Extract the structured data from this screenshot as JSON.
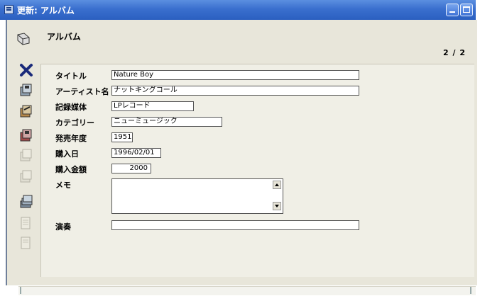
{
  "window": {
    "title": "更新: アルバム",
    "title_icon": "grid-window-icon",
    "minimize_icon": "minimize-icon",
    "maximize_icon": "maximize-icon"
  },
  "header": {
    "title": "アルバム",
    "record_count": "2 / 2",
    "icon": "book-page-icon"
  },
  "toolbar": {
    "icons": [
      "delete-x-icon",
      "save-disk-icon",
      "edit-disk-icon",
      "copy-disk-icon",
      "disabled-disk-icon",
      "disabled-disk2-icon",
      "stack-disk-icon",
      "disabled-folder-icon",
      "disabled-folder2-icon"
    ],
    "enabled": [
      true,
      true,
      true,
      true,
      false,
      false,
      true,
      false,
      false
    ]
  },
  "form": {
    "title_label": "タイトル",
    "title_value": "Nature Boy",
    "artist_label": "アーティスト名",
    "artist_value": "ナットキングコール",
    "media_label": "記録媒体",
    "media_value": "LPレコード",
    "category_label": "カテゴリー",
    "category_value": "ニューミュージック",
    "year_label": "発売年度",
    "year_value": "1951",
    "purchase_date_label": "購入日",
    "purchase_date_value": "1996/02/01",
    "price_label": "購入金額",
    "price_value": "2000",
    "memo_label": "メモ",
    "memo_value": "",
    "performer_label": "演奏",
    "performer_value": ""
  },
  "colors": {
    "titlebar": "#3a6fce",
    "panel": "#e8e6da",
    "content": "#f0efe6"
  }
}
